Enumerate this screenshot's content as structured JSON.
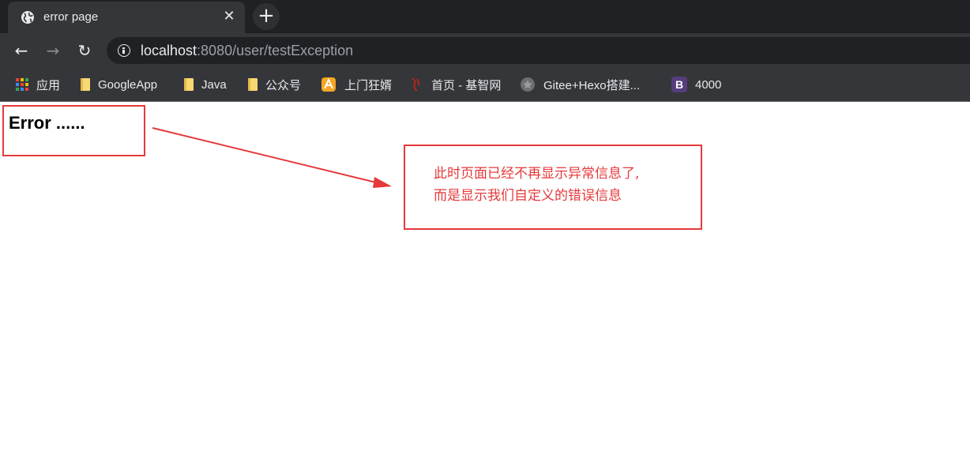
{
  "tab": {
    "title": "error page",
    "close_label": "✕",
    "icon": "globe-icon"
  },
  "new_tab": {
    "label": "+"
  },
  "nav": {
    "back": "←",
    "forward": "→",
    "reload": "↻"
  },
  "address": {
    "host": "localhost",
    "rest": ":8080/user/testException"
  },
  "bookmarks": [
    {
      "label": "应用",
      "icon": "apps-grid-icon"
    },
    {
      "label": "GoogleApp",
      "icon": "folder-icon"
    },
    {
      "label": "Java",
      "icon": "folder-icon"
    },
    {
      "label": "公众号",
      "icon": "folder-icon"
    },
    {
      "label": "上门狂婿",
      "icon": "site-favicon"
    },
    {
      "label": "首页 - 基智网",
      "icon": "site-favicon"
    },
    {
      "label": "Gitee+Hexo搭建...",
      "icon": "site-favicon"
    },
    {
      "label": "4000",
      "icon": "bootstrap-icon",
      "icon_text": "B"
    }
  ],
  "page": {
    "heading": "Error ......"
  },
  "annotation": {
    "line1": "此时页面已经不再显示异常信息了,",
    "line2": "而是显示我们自定义的错误信息"
  },
  "colors": {
    "annotation_red": "#e5393b",
    "chrome_dark": "#202124",
    "chrome_mid": "#35363a"
  }
}
